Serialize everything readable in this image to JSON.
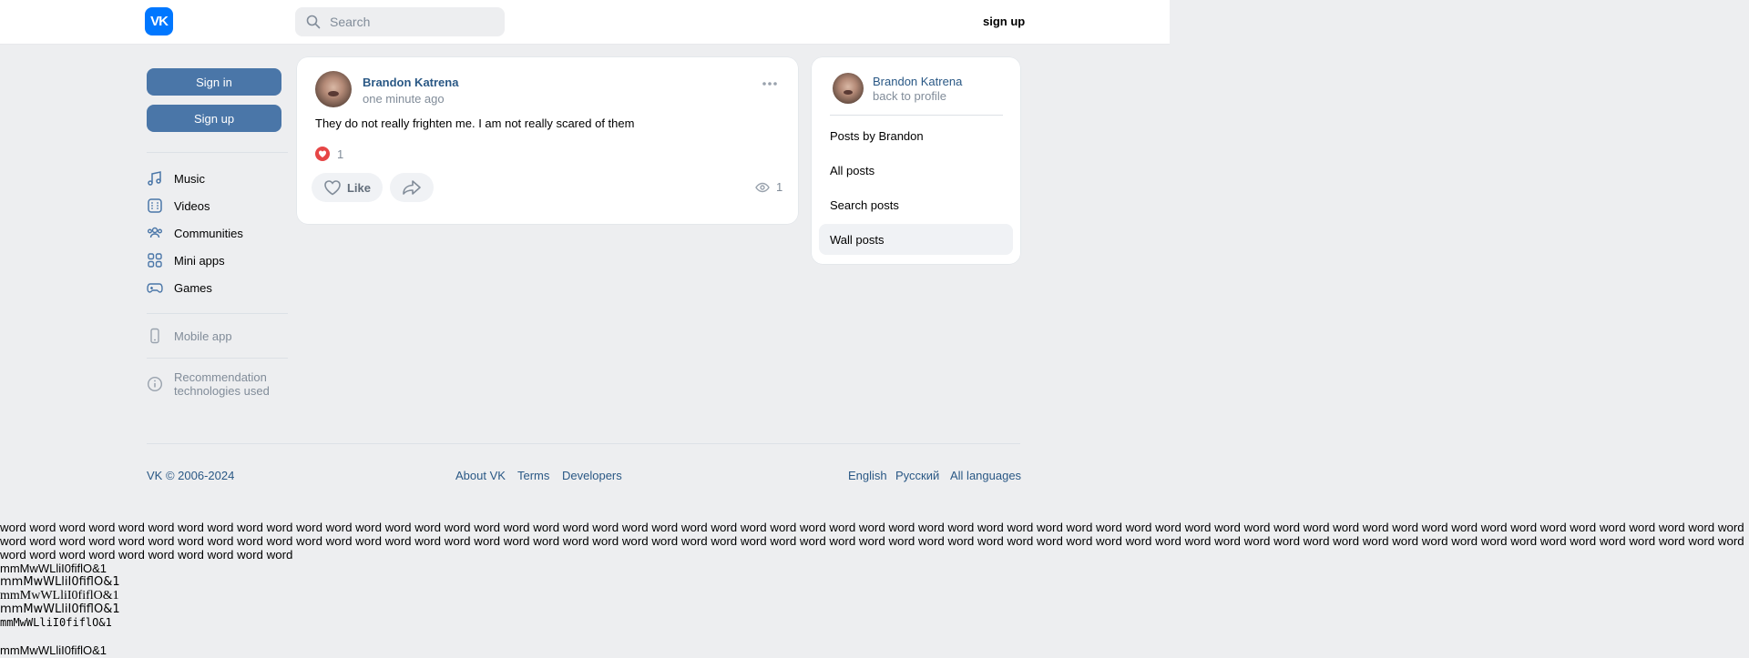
{
  "header": {
    "logo": "VK",
    "search_placeholder": "Search",
    "signup": "sign up"
  },
  "sidebar": {
    "signin_button": "Sign in",
    "signup_button": "Sign up",
    "items": [
      {
        "label": "Music",
        "icon": "music-icon"
      },
      {
        "label": "Videos",
        "icon": "video-icon"
      },
      {
        "label": "Communities",
        "icon": "communities-icon"
      },
      {
        "label": "Mini apps",
        "icon": "mini-apps-icon"
      },
      {
        "label": "Games",
        "icon": "gamepad-icon"
      }
    ],
    "mobile_app": "Mobile app",
    "recommendation": "Recommendation technologies used"
  },
  "post": {
    "author": "Brandon Katrena",
    "time": "one minute ago",
    "text": "They do not really frighten me. I am not really scared of them",
    "reactions_count": "1",
    "like_label": "Like",
    "views": "1"
  },
  "right_panel": {
    "name": "Brandon Katrena",
    "back": "back to profile",
    "items": [
      "Posts by Brandon",
      "All posts",
      "Search posts",
      "Wall posts"
    ],
    "selected": "Wall posts"
  },
  "footer": {
    "copyright": "VK © 2006-2024",
    "links": [
      "About VK",
      "Terms",
      "Developers"
    ],
    "languages": [
      "English",
      "Русский",
      "All languages"
    ]
  },
  "test_text": {
    "words": "word word word word word word word word word word word word word word word word word word word word word word word word word word word word word word word word word word word word word word word word word word word word word word word word word word word word word word word word word word word word word word word word word word word word word word word word word word word word word word word word word word word word word word word word word word word word word word word word word word word word word word word word word word word word word word word word word word word word word word word word word word word word word word word word",
    "lines": [
      "mmMwWLliI0fiflO&1",
      "mmMwWLliI0fiflO&1",
      "mmMwWLliI0fiflO&1",
      "mmMwWLliI0fiflO&1",
      "mmMwWLliI0fiflO&1",
      "mmMwWLliI0fiflO&1"
    ]
  }
}
